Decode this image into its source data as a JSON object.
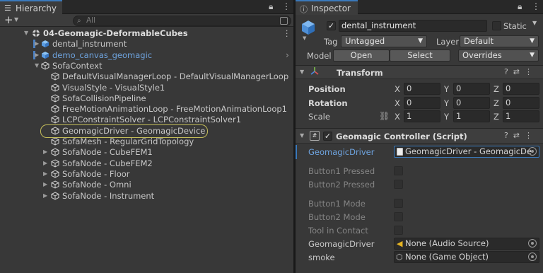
{
  "hierarchy": {
    "tab_label": "Hierarchy",
    "add_label": "+",
    "search_placeholder": "All",
    "rows": [
      {
        "label": "04-Geomagic-DeformableCubes",
        "expanded": true,
        "type": "scene",
        "bold": true,
        "indent": 0,
        "link": false
      },
      {
        "label": "dental_instrument",
        "expanded": false,
        "type": "prefab",
        "indent": 1,
        "link": false,
        "tri": true
      },
      {
        "label": "demo_canvas_geomagic",
        "expanded": false,
        "type": "prefab",
        "indent": 1,
        "link": true,
        "tri": true,
        "chevron": true
      },
      {
        "label": "SofaContext",
        "expanded": true,
        "type": "object",
        "indent": 1,
        "link": false,
        "tri": true
      },
      {
        "label": "DefaultVisualManagerLoop  -  DefaultVisualManagerLoop",
        "type": "object",
        "indent": 2
      },
      {
        "label": "VisualStyle  -  VisualStyle1",
        "type": "object",
        "indent": 2
      },
      {
        "label": "SofaCollisionPipeline",
        "type": "object",
        "indent": 2
      },
      {
        "label": "FreeMotionAnimationLoop  -  FreeMotionAnimationLoop1",
        "type": "object",
        "indent": 2
      },
      {
        "label": "LCPConstraintSolver  -  LCPConstraintSolver1",
        "type": "object",
        "indent": 2
      },
      {
        "label": "GeomagicDriver  -  GeomagicDevice",
        "type": "object",
        "indent": 2
      },
      {
        "label": "SofaMesh  -  RegularGridTopology",
        "type": "object",
        "indent": 2
      },
      {
        "label": "SofaNode - CubeFEM1",
        "type": "object",
        "indent": 2,
        "tri": true
      },
      {
        "label": "SofaNode - CubeFEM2",
        "type": "object",
        "indent": 2,
        "tri": true
      },
      {
        "label": "SofaNode - Floor",
        "type": "object",
        "indent": 2,
        "tri": true
      },
      {
        "label": "SofaNode - Omni",
        "type": "object",
        "indent": 2,
        "tri": true
      },
      {
        "label": "SofaNode - Instrument",
        "type": "object",
        "indent": 2,
        "tri": true
      }
    ]
  },
  "inspector": {
    "tab_label": "Inspector",
    "object_name": "dental_instrument",
    "static_label": "Static",
    "tag_label": "Tag",
    "tag_value": "Untagged",
    "layer_label": "Layer",
    "layer_value": "Default",
    "model_label": "Model",
    "open_label": "Open",
    "select_label": "Select",
    "overrides_label": "Overrides",
    "transform": {
      "title": "Transform",
      "rows": [
        {
          "label": "Position",
          "x": "0",
          "y": "0",
          "z": "0"
        },
        {
          "label": "Rotation",
          "x": "0",
          "y": "0",
          "z": "0"
        },
        {
          "label": "Scale",
          "x": "1",
          "y": "1",
          "z": "1"
        }
      ]
    },
    "script": {
      "title": "Geomagic Controller (Script)",
      "fields": [
        {
          "label": "GeomagicDriver",
          "value": "GeomagicDriver  -  GeomagicDe",
          "kind": "ref",
          "active": true
        },
        {
          "label": "Button1 Pressed",
          "kind": "check",
          "dim": true
        },
        {
          "label": "Button2 Pressed",
          "kind": "check",
          "dim": true
        },
        {
          "label": "Button1 Mode",
          "kind": "check",
          "dim": true
        },
        {
          "label": "Button2 Mode",
          "kind": "check",
          "dim": true
        },
        {
          "label": "Tool in Contact",
          "kind": "check",
          "dim": true
        },
        {
          "label": "GeomagicDriver",
          "value": "None (Audio Source)",
          "kind": "audio"
        },
        {
          "label": "smoke",
          "value": "None (Game Object)",
          "kind": "go"
        }
      ]
    },
    "axes": [
      "X",
      "Y",
      "Z"
    ]
  },
  "colors": {
    "accent": "#3a79bb",
    "link": "#6ea3de",
    "highlight": "#c4bd5a"
  }
}
